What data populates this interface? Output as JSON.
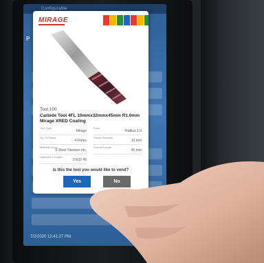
{
  "screen": {
    "topbar_text": "Configurable",
    "left_tab": "P",
    "timestamp": "7/2/2020 12:41:27 PM"
  },
  "dialog": {
    "logo_text": "MIRAGE",
    "tool_label": "Tool 100",
    "tool_name": "Carbide Tool 4FL 10mmx32mmx45mm R1.0mm Mirage XRED Coating",
    "specs": [
      {
        "key": "Tool Type",
        "value": "Mirage"
      },
      {
        "key": "Form",
        "value": "Radius 1.0"
      },
      {
        "key": "No. Of Flutes",
        "value": "4 Flutes"
      },
      {
        "key": "Shank Diameter",
        "value": "10 mm"
      },
      {
        "key": "Material Group",
        "value": "S Steel Titanium etc."
      },
      {
        "key": "Overall Length",
        "value": "45 mm"
      },
      {
        "key": "Diameter x Length",
        "value": "10x32 45"
      }
    ],
    "question": "Is this the tool you would like to vend?",
    "yes_label": "Yes",
    "no_label": "No"
  },
  "colors": {
    "screen_blue": "#3f77b4",
    "yes_button": "#1f66b8",
    "no_button": "#6a6a6a",
    "logo_red": "#c9362a"
  }
}
